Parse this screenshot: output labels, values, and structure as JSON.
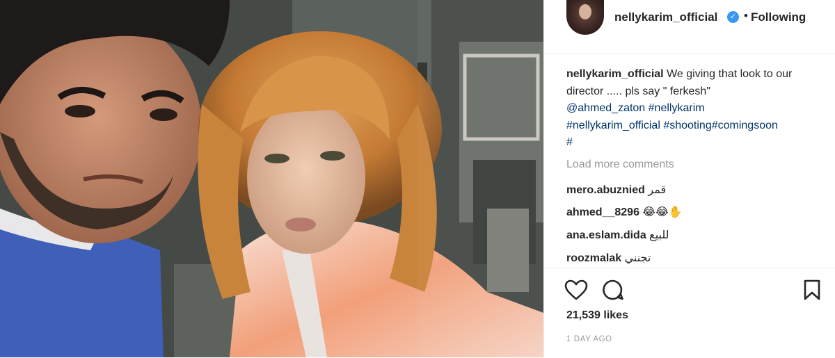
{
  "header": {
    "username": "nellykarim_official",
    "separator": "•",
    "follow_label": "Following",
    "verified_mark": "✓"
  },
  "caption": {
    "username": "nellykarim_official",
    "text": "We giving that look to our director ..... pls say \" ferkesh\"",
    "mention": "@ahmed_zaton",
    "tags": [
      "#nellykarim",
      "#nellykarim_official",
      "#shooting#comingsoon",
      "#"
    ]
  },
  "load_more_label": "Load more comments",
  "comments": [
    {
      "username": "mero.abuznied",
      "text": "قمر"
    },
    {
      "username": "ahmed__8296",
      "text": "😂😂✋"
    },
    {
      "username": "ana.eslam.dida",
      "text": "للبيع"
    },
    {
      "username": "roozmalak",
      "text": "تجنني"
    }
  ],
  "actions": {
    "like_icon": "heart-icon",
    "comment_icon": "comment-icon",
    "save_icon": "bookmark-icon"
  },
  "likes": "21,539 likes",
  "timestamp": "1 DAY AGO",
  "colors": {
    "link": "#003569",
    "muted": "#999999",
    "verified": "#3897f0",
    "divider": "#efefef"
  }
}
